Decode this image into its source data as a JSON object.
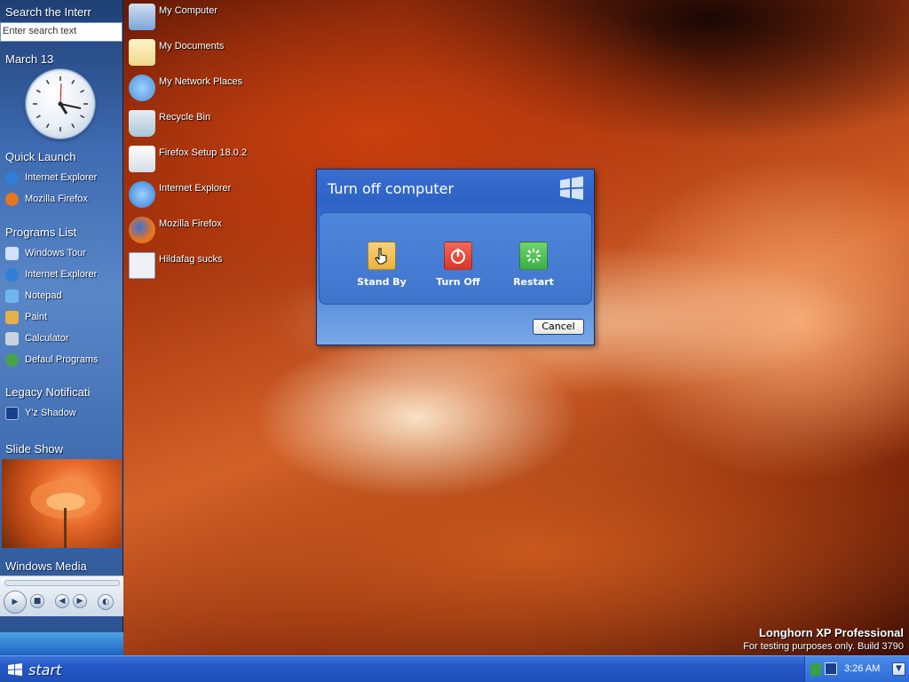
{
  "sidebar": {
    "search_title": "Search the Interr",
    "search_placeholder": "Enter search text",
    "date": "March 13",
    "quick_launch": {
      "title": "Quick Launch",
      "items": [
        {
          "label": "Internet Explorer",
          "icon": "internet-explorer-icon",
          "color": "#2f7fd6"
        },
        {
          "label": "Mozilla Firefox",
          "icon": "firefox-icon",
          "color": "#e8761c"
        }
      ]
    },
    "programs": {
      "title": "Programs List",
      "items": [
        {
          "label": "Windows Tour",
          "icon": "windows-tour-icon",
          "color": "#cfe3ff"
        },
        {
          "label": "Internet Explorer",
          "icon": "internet-explorer-icon",
          "color": "#2f7fd6"
        },
        {
          "label": "Notepad",
          "icon": "notepad-icon",
          "color": "#6fb5f0"
        },
        {
          "label": "Paint",
          "icon": "paint-icon",
          "color": "#e6b04a"
        },
        {
          "label": "Calculator",
          "icon": "calculator-icon",
          "color": "#c9d2de"
        },
        {
          "label": "Defaul Programs",
          "icon": "default-programs-icon",
          "color": "#46a34b"
        }
      ]
    },
    "legacy": {
      "title": "Legacy Notificati",
      "items": [
        {
          "label": "Y'z Shadow",
          "icon": "yz-shadow-icon",
          "color": "#1a3f8a"
        }
      ]
    },
    "slideshow_title": "Slide Show",
    "media_title": "Windows Media"
  },
  "desktop_icons": [
    {
      "label": "My Computer",
      "icon": "my-computer-icon",
      "color": "#7aa4d8"
    },
    {
      "label": "My Documents",
      "icon": "my-documents-icon",
      "color": "#f0d88a"
    },
    {
      "label": "My Network Places",
      "icon": "network-places-icon",
      "color": "#4b8fd6"
    },
    {
      "label": "Recycle Bin",
      "icon": "recycle-bin-icon",
      "color": "#a9c4d8"
    },
    {
      "label": "Firefox Setup 18.0.2",
      "icon": "installer-icon",
      "color": "#d6dbe6"
    },
    {
      "label": "Internet Explorer",
      "icon": "internet-explorer-icon",
      "color": "#2f7fd6"
    },
    {
      "label": "Mozilla Firefox",
      "icon": "firefox-icon",
      "color": "#e8761c"
    },
    {
      "label": "Hildafag sucks",
      "icon": "text-file-icon",
      "color": "#eef2f8"
    }
  ],
  "dialog": {
    "title": "Turn off computer",
    "buttons": [
      {
        "label": "Stand By",
        "icon": "standby-icon",
        "color": "#e9b33a"
      },
      {
        "label": "Turn Off",
        "icon": "power-icon",
        "color": "#d9352a"
      },
      {
        "label": "Restart",
        "icon": "restart-icon",
        "color": "#3bb045"
      }
    ],
    "cancel_label": "Cancel"
  },
  "watermark": {
    "title": "Longhorn XP Professional",
    "subtitle": "For testing purposes only. Build 3790"
  },
  "taskbar": {
    "start_label": "start",
    "time": "3:26 AM"
  }
}
